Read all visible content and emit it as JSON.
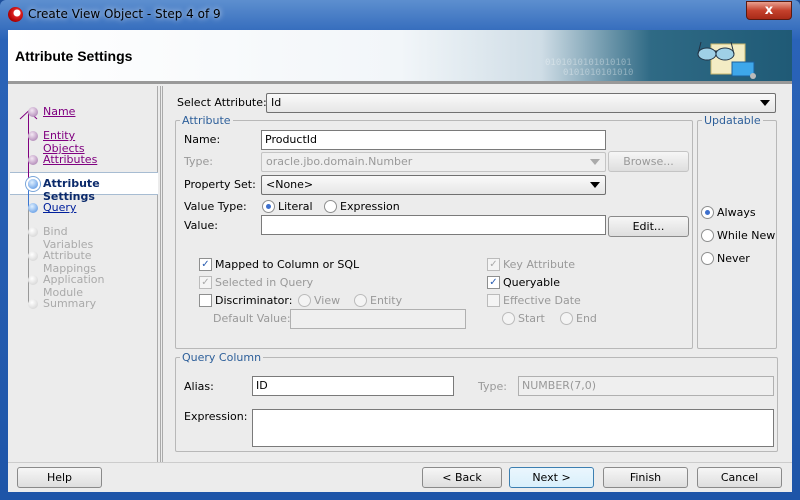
{
  "window": {
    "title": "Create View Object - Step 4 of 9",
    "close": "x"
  },
  "header": {
    "title": "Attribute Settings",
    "bits1": "0101010101010101",
    "bits2": "0101010101010"
  },
  "nav": [
    {
      "label": "Name",
      "state": "done"
    },
    {
      "label": "Entity Objects",
      "state": "done"
    },
    {
      "label": "Attributes",
      "state": "done"
    },
    {
      "label": "Attribute Settings",
      "state": "current"
    },
    {
      "label": "Query",
      "state": "link"
    },
    {
      "label": "Bind Variables",
      "state": "disabled"
    },
    {
      "label": "Attribute Mappings",
      "state": "disabled"
    },
    {
      "label": "Application Module",
      "state": "disabled"
    },
    {
      "label": "Summary",
      "state": "disabled"
    }
  ],
  "select_attribute": {
    "label": "Select Attribute:",
    "value": "Id"
  },
  "attribute": {
    "legend": "Attribute",
    "name_label": "Name:",
    "name_value": "ProductId",
    "type_label": "Type:",
    "type_value": "oracle.jbo.domain.Number",
    "browse": "Browse...",
    "property_set_label": "Property Set:",
    "property_set_value": "<None>",
    "value_type_label": "Value Type:",
    "literal": "Literal",
    "expression": "Expression",
    "value_label": "Value:",
    "value_value": "",
    "edit": "Edit...",
    "mapped": "Mapped to Column or SQL",
    "selected_in_query": "Selected in Query",
    "discriminator": "Discriminator:",
    "view": "View",
    "entity": "Entity",
    "default_value": "Default Value:",
    "key_attribute": "Key Attribute",
    "queryable": "Queryable",
    "effective_date": "Effective Date",
    "start": "Start",
    "end": "End"
  },
  "updatable": {
    "legend": "Updatable",
    "always": "Always",
    "while_new": "While New",
    "never": "Never"
  },
  "query_column": {
    "legend": "Query Column",
    "alias_label": "Alias:",
    "alias_value": "ID",
    "type_label": "Type:",
    "type_value": "NUMBER(7,0)",
    "expression_label": "Expression:"
  },
  "buttons": {
    "help": "Help",
    "back": "< Back",
    "next": "Next >",
    "finish": "Finish",
    "cancel": "Cancel"
  },
  "check": "✓"
}
